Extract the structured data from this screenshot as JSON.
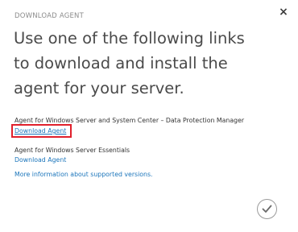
{
  "dialog": {
    "kicker": "DOWNLOAD AGENT",
    "headline": "Use one of the following links to download and install the agent for your server.",
    "close_icon": "close-icon",
    "confirm_icon": "checkmark-icon"
  },
  "sections": [
    {
      "label": "Agent for Windows Server and System Center – Data Protection Manager",
      "link": "Download Agent"
    },
    {
      "label": "Agent for Windows Server Essentials",
      "link": "Download Agent"
    }
  ],
  "more_info": "More information about supported versions.",
  "colors": {
    "link": "#1b75bb",
    "highlight": "#e0202c",
    "headline": "#4a4a4a"
  }
}
